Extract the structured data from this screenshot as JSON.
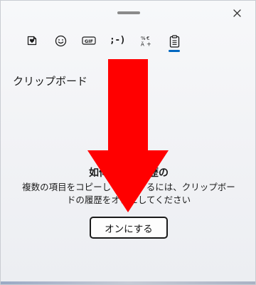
{
  "window": {
    "close_icon": "close-icon"
  },
  "tabs": [
    {
      "id": "stickers",
      "icon": "heart-sticker-icon",
      "label": ""
    },
    {
      "id": "emoji",
      "icon": "smiley-icon",
      "label": ""
    },
    {
      "id": "gif",
      "icon": "gif-icon",
      "label": "GIF"
    },
    {
      "id": "kaomoji",
      "icon": "kaomoji-icon",
      "label": ";-)"
    },
    {
      "id": "symbols",
      "icon": "symbols-icon",
      "label": ""
    },
    {
      "id": "clipboard",
      "icon": "clipboard-icon",
      "label": "",
      "active": true
    }
  ],
  "section": {
    "title": "クリップボード"
  },
  "empty_state": {
    "title": "如何コピー履歴の",
    "description": "複数の項目をコピーして表示するには、クリップボードの履歴をオンにしてください"
  },
  "actions": {
    "turn_on_label": "オンにする"
  },
  "annotation": {
    "arrow_color": "#ff0000"
  },
  "colors": {
    "accent": "#0067c0",
    "background": "#f4f5f7"
  }
}
